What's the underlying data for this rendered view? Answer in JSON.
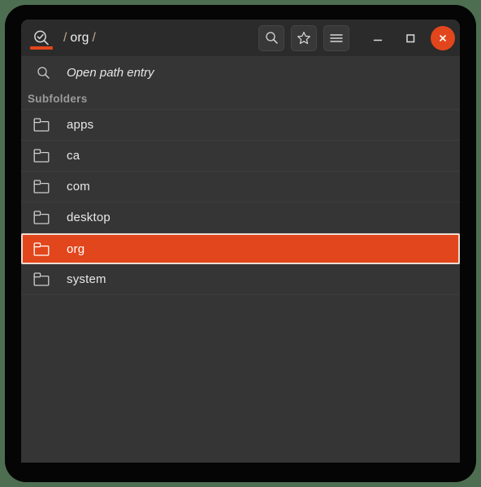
{
  "window": {
    "title_path": {
      "segments": [
        "org"
      ],
      "separator": "/"
    },
    "app_icon": "magnifier-check-icon",
    "accent_color": "#e2461c",
    "header_bg": "#2b2b2b",
    "body_bg": "#353535"
  },
  "titlebar": {
    "tools": [
      {
        "name": "search-button",
        "icon": "search-icon"
      },
      {
        "name": "bookmark-button",
        "icon": "star-icon"
      },
      {
        "name": "menu-button",
        "icon": "hamburger-menu-icon"
      }
    ],
    "window_controls": [
      {
        "name": "minimize-button",
        "icon": "minimize-icon"
      },
      {
        "name": "maximize-button",
        "icon": "maximize-icon"
      },
      {
        "name": "close-button",
        "icon": "close-icon"
      }
    ]
  },
  "path_entry": {
    "icon": "search-icon",
    "placeholder": "Open path entry",
    "value": ""
  },
  "list": {
    "section_label": "Subfolders",
    "items": [
      {
        "label": "apps",
        "icon": "folder-icon",
        "selected": false
      },
      {
        "label": "ca",
        "icon": "folder-icon",
        "selected": false
      },
      {
        "label": "com",
        "icon": "folder-icon",
        "selected": false
      },
      {
        "label": "desktop",
        "icon": "folder-icon",
        "selected": false
      },
      {
        "label": "org",
        "icon": "folder-icon",
        "selected": true
      },
      {
        "label": "system",
        "icon": "folder-icon",
        "selected": false
      }
    ]
  }
}
